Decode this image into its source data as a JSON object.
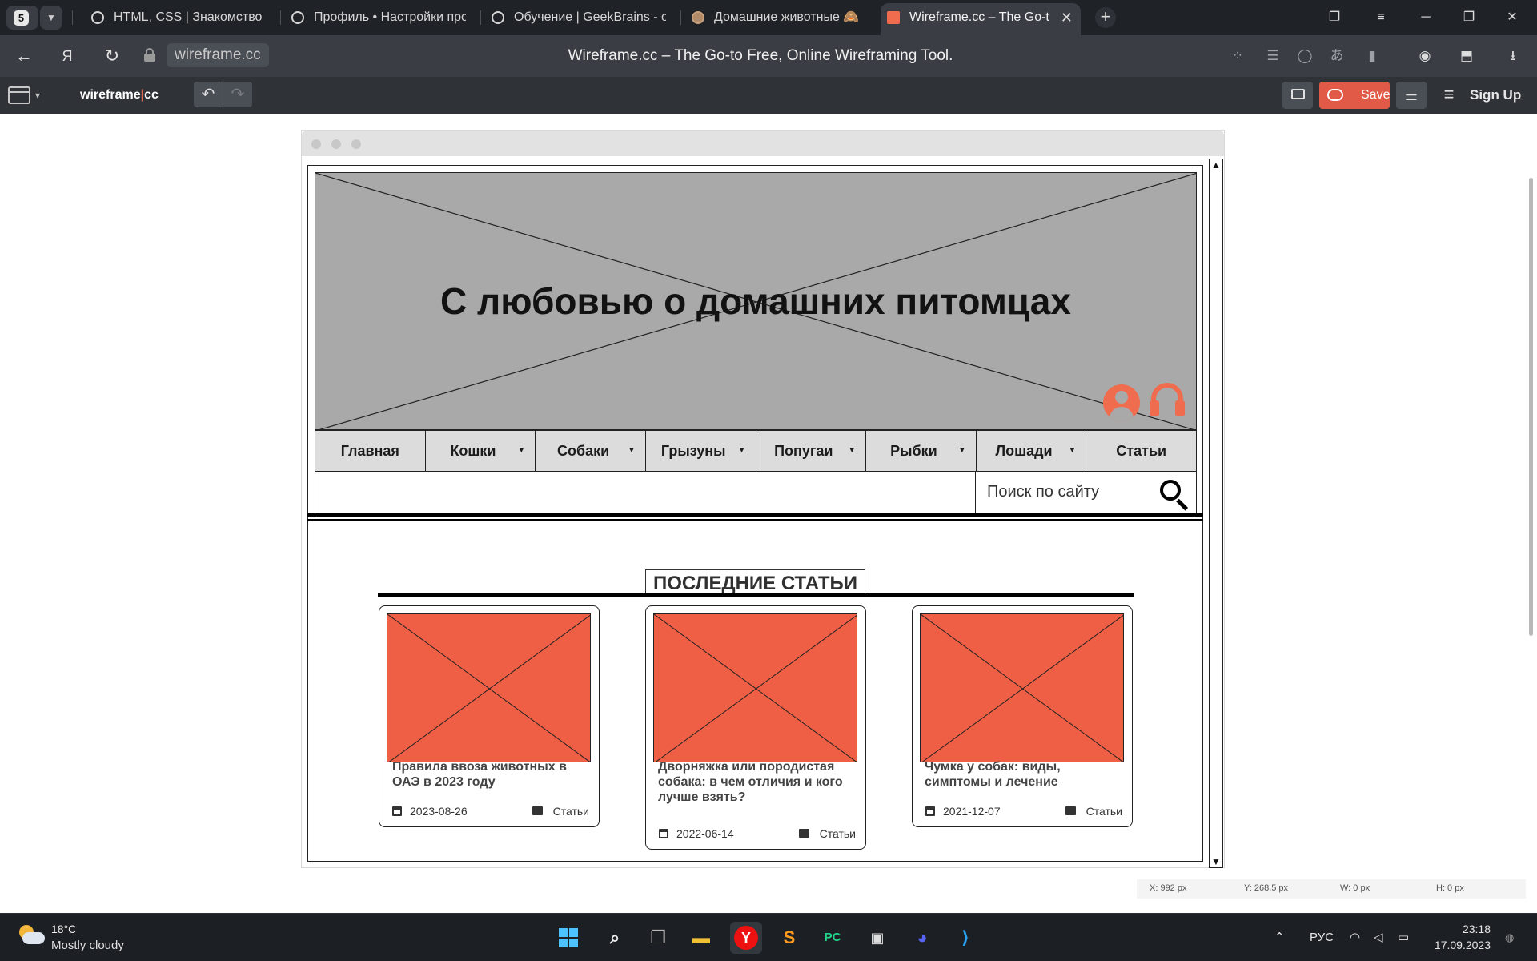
{
  "browser": {
    "tab_count": "5",
    "tabs": [
      {
        "title": "HTML, CSS | Знакомство с",
        "icon": "openai-icon"
      },
      {
        "title": "Профиль • Настройки про",
        "icon": "openai-icon"
      },
      {
        "title": "Обучение | GeekBrains - о",
        "icon": "openai-icon"
      },
      {
        "title": "Домашние животные 🙈",
        "icon": "pet-icon"
      },
      {
        "title": "Wireframe.cc – The Go-t",
        "icon": "wireframe-icon"
      }
    ],
    "url": "wireframe.cc",
    "page_title": "Wireframe.cc – The Go-to Free, Online Wireframing Tool."
  },
  "app": {
    "logo_left": "wireframe",
    "logo_sep": "|",
    "logo_right": "cc",
    "save_label": "Save",
    "signup_label": "Sign Up",
    "accent_color": "#ef6c4f"
  },
  "wireframe": {
    "hero_title": "С любовью о домашних питомцах",
    "nav": [
      {
        "label": "Главная",
        "dropdown": false
      },
      {
        "label": "Кошки",
        "dropdown": true
      },
      {
        "label": "Собаки",
        "dropdown": true
      },
      {
        "label": "Грызуны",
        "dropdown": true
      },
      {
        "label": "Попугаи",
        "dropdown": true
      },
      {
        "label": "Рыбки",
        "dropdown": true
      },
      {
        "label": "Лошади",
        "dropdown": true
      },
      {
        "label": "Статьи",
        "dropdown": false
      }
    ],
    "search_placeholder": "Поиск по сайту",
    "section_title": "ПОСЛЕДНИЕ СТАТЬИ",
    "articles": [
      {
        "title": "Правила ввоза животных в ОАЭ в 2023 году",
        "date": "2023-08-26",
        "category": "Статьи"
      },
      {
        "title": "Дворняжка или породистая собака: в чем отличия и кого лучше взять?",
        "date": "2022-06-14",
        "category": "Статьи"
      },
      {
        "title": "Чумка у собак: виды, симптомы и лечение",
        "date": "2021-12-07",
        "category": "Статьи"
      }
    ]
  },
  "statusbar": {
    "x": "X: 992 px",
    "y": "Y: 268.5 px",
    "w": "W: 0 px",
    "h": "H: 0 px"
  },
  "taskbar": {
    "temperature": "18°C",
    "condition": "Mostly cloudy",
    "language": "РУС",
    "time": "23:18",
    "date": "17.09.2023"
  }
}
